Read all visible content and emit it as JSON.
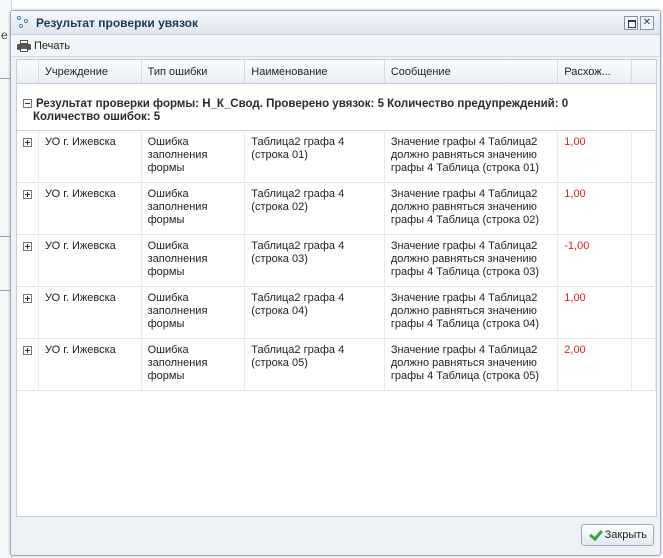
{
  "window": {
    "title": "Результат проверки увязок",
    "icon": "link-check-icon"
  },
  "toolbar": {
    "print_label": "Печать",
    "print_icon": "printer-icon"
  },
  "grid": {
    "columns": [
      "",
      "Учреждение",
      "Тип ошибки",
      "Наименование",
      "Сообщение",
      "Расхож..."
    ],
    "group": {
      "line1": "Результат проверки формы: Н_К_Свод. Проверено увязок: 5 Количество предупреждений: 0",
      "line2": "Количество ошибок: 5"
    },
    "rows": [
      {
        "institution": "УО г. Ижевска",
        "error_type": "Ошибка заполнения формы",
        "name": "Таблица2 графа 4 (строка 01)",
        "message": "Значение графы 4 Таблица2 должно равняться значению графы 4 Таблица (строка 01)",
        "diff": "1,00"
      },
      {
        "institution": "УО г. Ижевска",
        "error_type": "Ошибка заполнения формы",
        "name": "Таблица2 графа 4 (строка 02)",
        "message": "Значение графы 4 Таблица2 должно равняться значению графы 4 Таблица (строка 02)",
        "diff": "1,00"
      },
      {
        "institution": "УО г. Ижевска",
        "error_type": "Ошибка заполнения формы",
        "name": "Таблица2 графа 4 (строка 03)",
        "message": "Значение графы 4 Таблица2 должно равняться значению графы 4 Таблица (строка 03)",
        "diff": "-1,00"
      },
      {
        "institution": "УО г. Ижевска",
        "error_type": "Ошибка заполнения формы",
        "name": "Таблица2 графа 4 (строка 04)",
        "message": "Значение графы 4 Таблица2 должно равняться значению графы 4 Таблица (строка 04)",
        "diff": "1,00"
      },
      {
        "institution": "УО г. Ижевска",
        "error_type": "Ошибка заполнения формы",
        "name": "Таблица2 графа 4 (строка 05)",
        "message": "Значение графы 4 Таблица2 должно равняться значению графы 4 Таблица (строка 05)",
        "diff": "2,00"
      }
    ]
  },
  "footer": {
    "close_label": "Закрыть",
    "close_icon": "checkmark-icon"
  },
  "background": {
    "fragment_text": "e"
  },
  "colors": {
    "diff_text": "#e0201b",
    "title_text": "#1b3a5c",
    "check_green": "#3aa53a"
  }
}
